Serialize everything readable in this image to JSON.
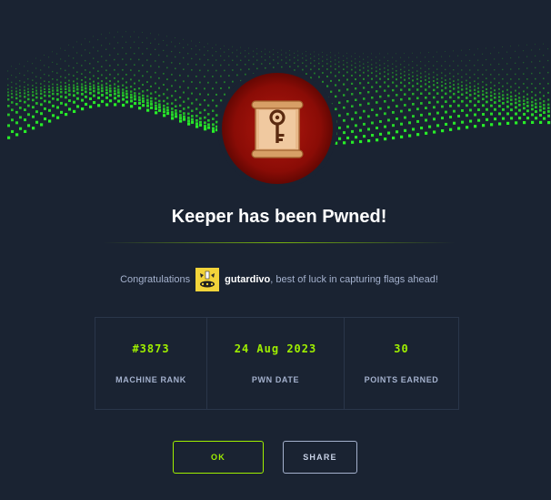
{
  "modal": {
    "title": "Keeper has been Pwned!",
    "congrats_prefix": "Congratulations",
    "username": "gutardivo",
    "congrats_suffix": ", best of luck in capturing flags ahead!",
    "badge_icon": "key-scroll-icon",
    "banner_icon": "green-wave-grid"
  },
  "stats": [
    {
      "value": "#3873",
      "label": "MACHINE RANK"
    },
    {
      "value": "24 Aug 2023",
      "label": "PWN DATE"
    },
    {
      "value": "30",
      "label": "POINTS EARNED"
    }
  ],
  "buttons": {
    "ok": "OK",
    "share": "SHARE"
  },
  "colors": {
    "accent": "#9fef00",
    "background": "#1a2332",
    "muted_text": "#a4b1cd"
  }
}
